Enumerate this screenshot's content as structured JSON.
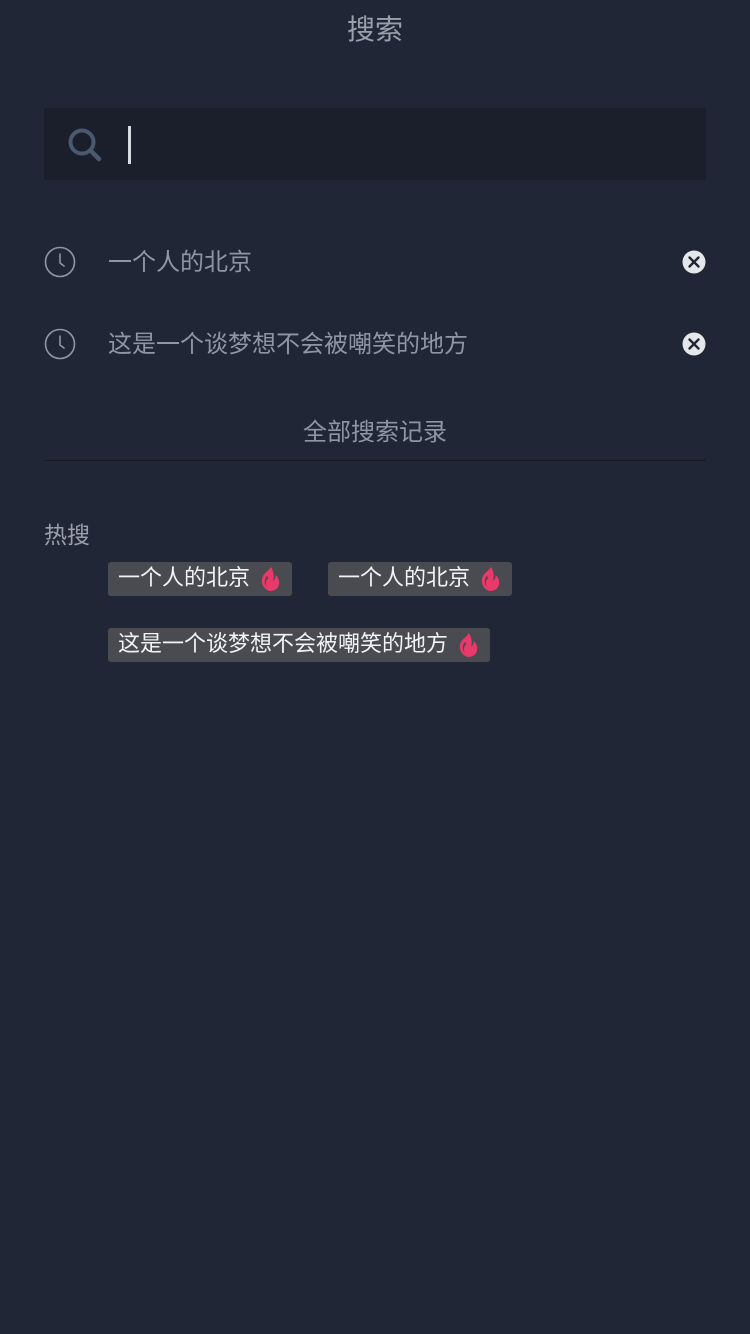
{
  "header": {
    "title": "搜索"
  },
  "search": {
    "value": "",
    "placeholder": ""
  },
  "history": {
    "items": [
      {
        "label": "一个人的北京"
      },
      {
        "label": "这是一个谈梦想不会被嘲笑的地方"
      }
    ],
    "all_label": "全部搜索记录"
  },
  "hot": {
    "title": "热搜",
    "tags": [
      {
        "label": "一个人的北京"
      },
      {
        "label": "一个人的北京"
      },
      {
        "label": "这是一个谈梦想不会被嘲笑的地方"
      }
    ]
  },
  "colors": {
    "background": "#212636",
    "search_bg": "#1b1f2b",
    "tag_bg": "#4a4b50",
    "flame": "#e83a6a",
    "icon": "#4a5870"
  },
  "icons": {
    "search": "search-icon",
    "history": "clock-icon",
    "remove": "close-circle-icon",
    "hot": "flame-icon"
  }
}
